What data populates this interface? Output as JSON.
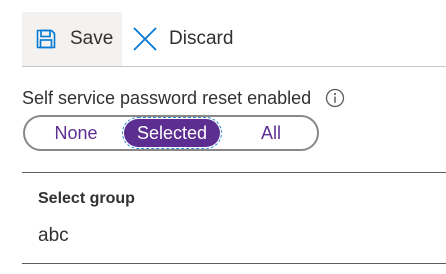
{
  "toolbar": {
    "save_label": "Save",
    "save_icon": "save-icon",
    "discard_label": "Discard",
    "discard_icon": "close-icon"
  },
  "sspr": {
    "label": "Self service password reset enabled",
    "info_icon": "info-icon",
    "options": [
      "None",
      "Selected",
      "All"
    ],
    "selected_option": "Selected"
  },
  "group": {
    "label": "Select group",
    "value": "abc"
  },
  "colors": {
    "accent": "#5c2e91",
    "focus_outline": "#2b88d8",
    "save_icon": "#0078d4",
    "discard_icon": "#0078d4",
    "text": "#323130"
  }
}
